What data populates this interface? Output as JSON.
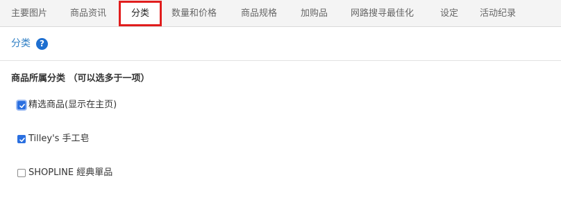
{
  "tabs": [
    {
      "label": "主要图片"
    },
    {
      "label": "商品资讯"
    },
    {
      "label": "分类",
      "active": true
    },
    {
      "label": "数量和价格"
    },
    {
      "label": "商品规格"
    },
    {
      "label": "加购品"
    },
    {
      "label": "网路搜寻最佳化"
    },
    {
      "label": "设定"
    },
    {
      "label": "活动纪录"
    }
  ],
  "section": {
    "title": "分类",
    "help_icon": "question-circle-icon",
    "help_glyph": "?"
  },
  "category_group": {
    "label": "商品所属分类 （可以选多于一项）",
    "options": [
      {
        "label": "精选商品(显示在主页)",
        "checked": true
      },
      {
        "label": "Tilley's 手工皂",
        "checked": true
      },
      {
        "label": "SHOPLINE 經典單品",
        "checked": false
      }
    ]
  },
  "colors": {
    "accent": "#2f7fc4",
    "checkbox_checked": "#2a6fe0",
    "active_tab_highlight": "#e11d1d"
  }
}
